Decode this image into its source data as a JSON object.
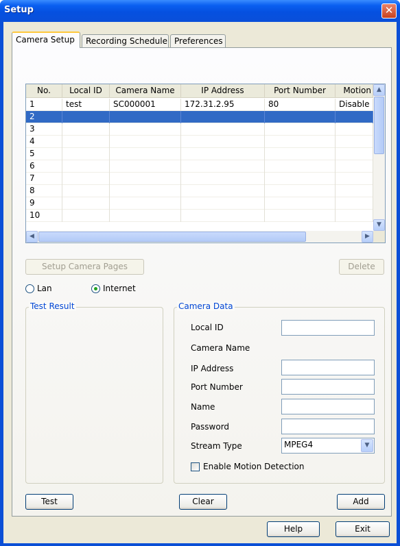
{
  "window": {
    "title": "Setup",
    "close_icon": "close-icon"
  },
  "tabs": [
    {
      "label": "Camera Setup",
      "active": true
    },
    {
      "label": "Recording Schedule",
      "active": false
    },
    {
      "label": "Preferences",
      "active": false
    }
  ],
  "grid": {
    "columns": [
      "No.",
      "Local ID",
      "Camera Name",
      "IP Address",
      "Port Number",
      "Motion"
    ],
    "rows": [
      [
        "1",
        "test",
        "SC000001",
        "172.31.2.95",
        "80",
        "Disable"
      ],
      [
        "2",
        "",
        "",
        "",
        "",
        ""
      ],
      [
        "3",
        "",
        "",
        "",
        "",
        ""
      ],
      [
        "4",
        "",
        "",
        "",
        "",
        ""
      ],
      [
        "5",
        "",
        "",
        "",
        "",
        ""
      ],
      [
        "6",
        "",
        "",
        "",
        "",
        ""
      ],
      [
        "7",
        "",
        "",
        "",
        "",
        ""
      ],
      [
        "8",
        "",
        "",
        "",
        "",
        ""
      ],
      [
        "9",
        "",
        "",
        "",
        "",
        ""
      ],
      [
        "10",
        "",
        "",
        "",
        "",
        ""
      ]
    ],
    "selected_row": 2
  },
  "buttons": {
    "setup_camera_pages": "Setup Camera Pages",
    "delete": "Delete",
    "test": "Test",
    "clear": "Clear",
    "add": "Add",
    "help": "Help",
    "exit": "Exit"
  },
  "connection": {
    "lan": "Lan",
    "internet": "Internet",
    "selected": "Internet"
  },
  "test_result": {
    "title": "Test Result"
  },
  "camera_data": {
    "title": "Camera Data",
    "local_id_label": "Local ID",
    "camera_name_label": "Camera Name",
    "ip_address_label": "IP Address",
    "port_number_label": "Port Number",
    "name_label": "Name",
    "password_label": "Password",
    "stream_type_label": "Stream Type",
    "stream_type_value": "MPEG4",
    "enable_motion_label": "Enable Motion Detection",
    "enable_motion_checked": false,
    "local_id_value": "",
    "ip_address_value": "",
    "port_number_value": "",
    "name_value": "",
    "password_value": ""
  }
}
